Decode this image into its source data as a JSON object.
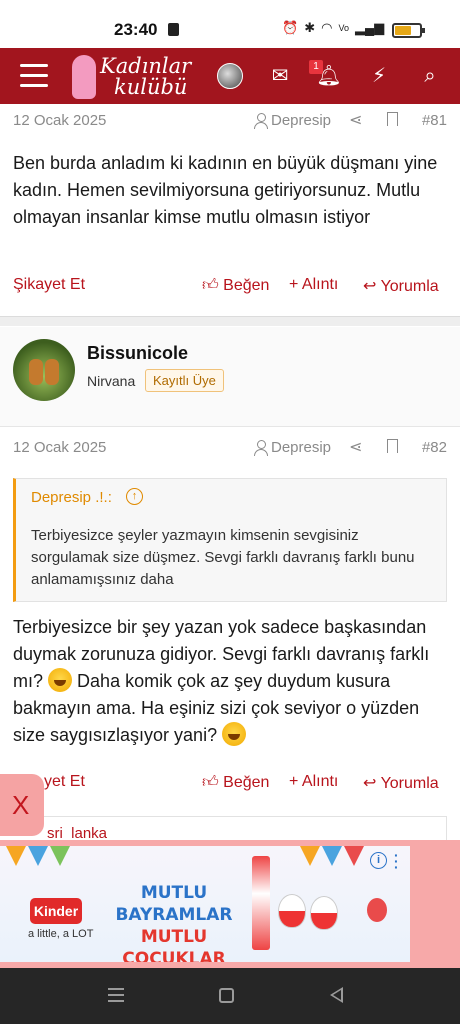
{
  "status_bar": {
    "time": "23:40",
    "battery_level": 0.6,
    "icons": [
      "alarm-icon",
      "bluetooth-icon",
      "wifi-icon",
      "volte-icon",
      "signal-icon",
      "battery-icon"
    ]
  },
  "header": {
    "logo_line1": "Kadınlar",
    "logo_line2": "kulübü",
    "notification_count": "1",
    "brand_color": "#a2151e"
  },
  "post81": {
    "date": "12 Ocak 2025",
    "author": "Depresip",
    "number": "#81",
    "body": "Ben burda anladım ki kadının en büyük düşmanı yine kadın. Hemen sevilmiyorsuna getiriyorsunuz. Mutlu olmayan insanlar kimse mutlu olmasın istiyor"
  },
  "actions": {
    "report": "Şikayet Et",
    "like": "Beğen",
    "quote": "Alıntı",
    "reply": "Yorumla"
  },
  "post82": {
    "username": "Bissunicole",
    "user_title": "Nirvana",
    "user_badge": "Kayıtlı Üye",
    "date": "12 Ocak 2025",
    "author": "Depresip",
    "number": "#82",
    "quote_author": "Depresip .!.:",
    "quote_text": "Terbiyesizce şeyler yazmayın kimsenin sevgisiniz sorgulamak size düşmez. Sevgi farklı davranış farklı bunu anlamamışsınız daha",
    "body_part1": "Terbiyesizce bir şey yazan yok sadece başkasından duymak zorunuza gidiyor. Sevgi farklı davranış farklı mı?",
    "body_part2": "Daha komik çok az şey duydum kusura bakmayın ama. Ha eşiniz sizi çok seviyor o yüzden size saygısızlaşıyor yani?",
    "report_partial": "yet Et"
  },
  "nested_quote_author": "sri_lanka",
  "ad": {
    "close_label": "X",
    "brand": "Kinder",
    "tagline": "a little, a LOT",
    "title_line1": "MUTLU BAYRAMLAR",
    "title_line2": "MUTLU ÇOCUKLAR",
    "info_label": "i"
  }
}
